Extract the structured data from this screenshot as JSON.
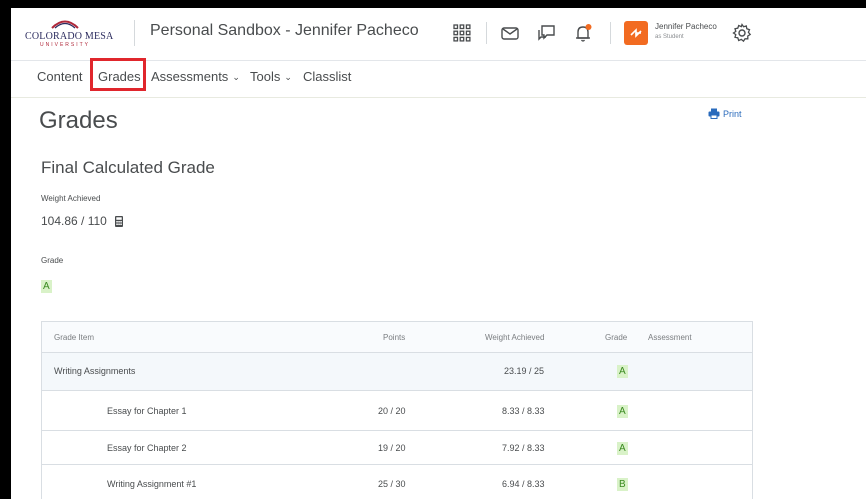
{
  "header": {
    "logo_main": "COLORADO MESA",
    "logo_sub": "UNIVERSITY",
    "course_title": "Personal Sandbox - Jennifer Pacheco",
    "user_name": "Jennifer Pacheco",
    "user_role": "as Student",
    "icons": [
      "waffle-icon",
      "mail-icon",
      "chat-icon",
      "bell-icon",
      "gear-icon"
    ],
    "notification_dot_color": "#f26b21"
  },
  "nav": {
    "content": "Content",
    "grades": "Grades",
    "assessments": "Assessments",
    "tools": "Tools",
    "classlist": "Classlist",
    "chevron": "⌄"
  },
  "main": {
    "title": "Grades",
    "print": "Print",
    "final_title": "Final Calculated Grade",
    "weight_label": "Weight Achieved",
    "weight_value": "104.86 / 110",
    "grade_label": "Grade",
    "grade_value": "A"
  },
  "table": {
    "headers": {
      "item": "Grade Item",
      "points": "Points",
      "weight": "Weight Achieved",
      "grade": "Grade",
      "assessment": "Assessment"
    },
    "rows": [
      {
        "item": "Writing Assignments",
        "points": "",
        "weight": "23.19 / 25",
        "grade": "A"
      },
      {
        "item": "Essay for Chapter 1",
        "points": "20 / 20",
        "weight": "8.33 / 8.33",
        "grade": "A"
      },
      {
        "item": "Essay for Chapter 2",
        "points": "19 / 20",
        "weight": "7.92 / 8.33",
        "grade": "A"
      },
      {
        "item": "Writing Assignment #1",
        "points": "25 / 30",
        "weight": "6.94 / 8.33",
        "grade": "B"
      }
    ]
  },
  "colors": {
    "highlight_box": "#e0262c",
    "grade_badge_bg": "#d9f2c8",
    "link_blue": "#2a6bbc"
  }
}
